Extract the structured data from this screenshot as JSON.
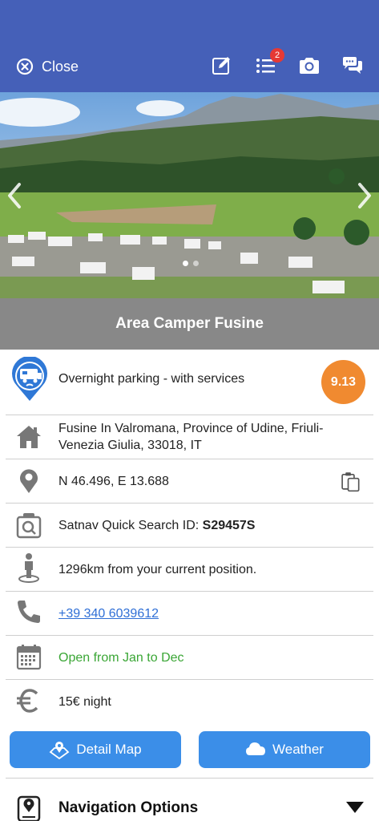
{
  "header": {
    "close_label": "Close",
    "list_badge_count": "2",
    "colors": {
      "bar": "#4560b8"
    }
  },
  "hero": {
    "slide_index": 1,
    "slide_count": 2
  },
  "place": {
    "title": "Area Camper Fusine",
    "category": "Overnight parking - with services",
    "score": "9.13",
    "address": "Fusine In Valromana, Province of Udine, Friuli-Venezia Giulia, 33018, IT",
    "coordinates": "N 46.496, E 13.688",
    "satnav_label": "Satnav Quick Search ID: ",
    "satnav_id": "S29457S",
    "distance": "1296km from your current position.",
    "phone": "+39 340 6039612",
    "opening": "Open from Jan to Dec",
    "price": "15€ night"
  },
  "buttons": {
    "detail_map": "Detail Map",
    "weather": "Weather"
  },
  "navigation": {
    "label": "Navigation Options"
  },
  "icons": [
    "close-icon",
    "edit-icon",
    "list-icon",
    "camera-icon",
    "chat-icon",
    "camper-pin-icon",
    "home-icon",
    "location-pin-icon",
    "clipboard-icon",
    "satnav-icon",
    "person-icon",
    "phone-icon",
    "calendar-icon",
    "euro-icon",
    "map-icon",
    "cloud-icon",
    "navigation-icon",
    "triangle-down-icon"
  ]
}
